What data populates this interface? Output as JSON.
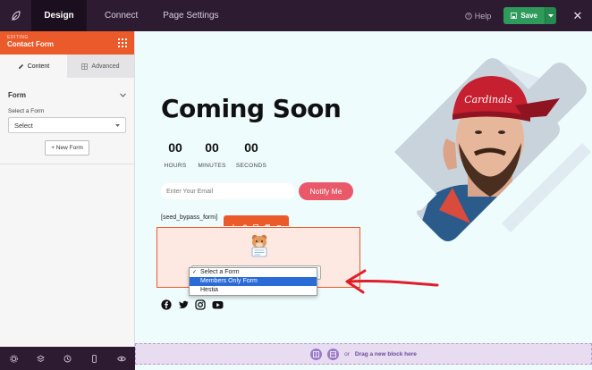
{
  "topbar": {
    "tabs": [
      {
        "label": "Design",
        "active": true
      },
      {
        "label": "Connect",
        "active": false
      },
      {
        "label": "Page Settings",
        "active": false
      }
    ],
    "help_label": "Help",
    "save_label": "Save"
  },
  "sidebar": {
    "editing_caption": "EDITING",
    "editing_name": "Contact Form",
    "tabs": [
      {
        "label": "Content",
        "icon": "pencil-icon",
        "active": true
      },
      {
        "label": "Advanced",
        "icon": "grid-icon",
        "active": false
      }
    ],
    "section_title": "Form",
    "select_label": "Select a Form",
    "select_value": "Select",
    "new_form_label": "+ New Form",
    "bottom_icons": [
      "gear-icon",
      "layers-icon",
      "history-icon",
      "mobile-icon",
      "eye-icon"
    ]
  },
  "canvas": {
    "title": "Coming Soon",
    "counters": [
      {
        "value": "00",
        "label": "HOURS"
      },
      {
        "value": "00",
        "label": "MINUTES"
      },
      {
        "value": "00",
        "label": "SECONDS"
      }
    ],
    "email_placeholder": "Enter Your Email",
    "notify_label": "Notify Me",
    "shortcode": "[seed_bypass_form]",
    "form_options": [
      {
        "label": "Select a Form",
        "selected": true,
        "highlighted": false
      },
      {
        "label": "Members Only Form",
        "selected": false,
        "highlighted": true
      },
      {
        "label": "Hestia",
        "selected": false,
        "highlighted": false
      }
    ],
    "social_icons": [
      "facebook-icon",
      "twitter-icon",
      "instagram-icon",
      "youtube-icon"
    ]
  },
  "dragbar": {
    "or_label": "or",
    "cta_label": "Drag a new block here"
  },
  "colors": {
    "topbar": "#2d1b32",
    "accent": "#ea5a2a",
    "save": "#2e9b5c",
    "notify": "#e9596a",
    "canvas_bg": "#eefcfd",
    "annotation_arrow": "#e01e2b"
  }
}
